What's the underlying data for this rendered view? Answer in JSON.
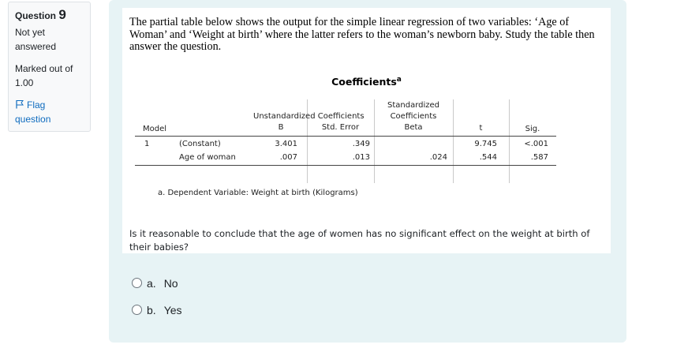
{
  "question_info": {
    "label": "Question",
    "number": "9",
    "state": "Not yet answered",
    "grade": "Marked out of 1.00",
    "flag_label": "Flag question"
  },
  "question": {
    "intro": "The partial table below shows the output for the simple linear regression of two variables: ‘Age of Woman’ and ‘Weight at birth’ where the latter refers to the woman’s newborn baby. Study the table then answer the question.",
    "table_title": "Coefficients",
    "table_title_sup": "a",
    "headers": {
      "unstandardized": "Unstandardized Coefficients",
      "standardized_line1": "Standardized",
      "standardized_line2": "Coefficients",
      "model": "Model",
      "b": "B",
      "std_error": "Std. Error",
      "beta": "Beta",
      "t": "t",
      "sig": "Sig."
    },
    "rows": [
      {
        "model": "1",
        "term": "(Constant)",
        "b": "3.401",
        "std_error": ".349",
        "beta": "",
        "t": "9.745",
        "sig": "<.001"
      },
      {
        "model": "",
        "term": "Age of woman",
        "b": ".007",
        "std_error": ".013",
        "beta": ".024",
        "t": ".544",
        "sig": ".587"
      }
    ],
    "footnote": "a. Dependent Variable: Weight at birth (Kilograms)",
    "prompt": "Is it reasonable to conclude that the age of women has no significant effect on the weight at birth of their babies?"
  },
  "answers": [
    {
      "letter": "a.",
      "text": "No"
    },
    {
      "letter": "b.",
      "text": "Yes"
    }
  ]
}
